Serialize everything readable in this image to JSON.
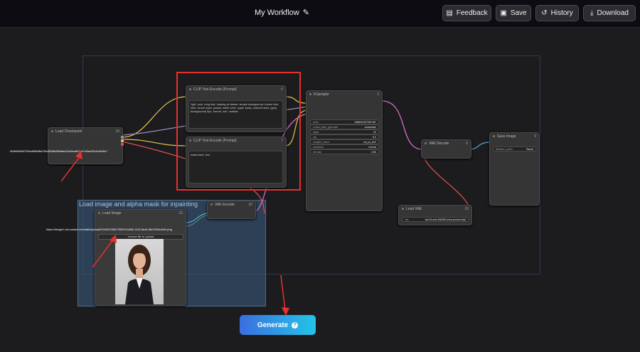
{
  "header": {
    "title": "My Workflow",
    "buttons": {
      "feedback": "Feedback",
      "save": "Save",
      "history": "History",
      "download": "Download"
    }
  },
  "nodes": {
    "load_checkpoint": {
      "title": "Load Checkpoint",
      "id": "29",
      "value": "0b5b0689470f4cd08b56a7f0c0558b2f8b8ed22a3ea5b7ae7d3ac02b2e4fd5c7"
    },
    "clip_pos": {
      "title": "CLIP Text Encode (Prompt)",
      "id": "6",
      "text": "1girl, solo, long hair, looking at viewer, simple background, brown hair, shirt, brown eyes, jacket, white shirt, upper body, collared shirt, (grey background) lips, formal, suit, realistic"
    },
    "clip_neg": {
      "title": "CLIP Text Encode (Prompt)",
      "id": "7",
      "text": "watermark, text"
    },
    "ksampler": {
      "title": "KSampler",
      "id": "3",
      "widgets": [
        {
          "label": "seed",
          "value": "1088411927287187"
        },
        {
          "label": "control_after_generate",
          "value": "randomize"
        },
        {
          "label": "steps",
          "value": "20"
        },
        {
          "label": "cfg",
          "value": "8.0"
        },
        {
          "label": "sampler_name",
          "value": "uni_pc_bh2"
        },
        {
          "label": "scheduler",
          "value": "normal"
        },
        {
          "label": "denoise",
          "value": "0.80"
        }
      ]
    },
    "vae_decode": {
      "title": "VAE Decode",
      "id": "8"
    },
    "save_image": {
      "title": "Save Image",
      "id": "9",
      "prefix_label": "filename_prefix",
      "prefix_value": "Result"
    },
    "load_vae": {
      "title": "Load VAE",
      "id": "33",
      "label": "vae",
      "value": "sdxl-ft-mse-840000-ema-pruned.ckpt"
    },
    "vae_encode": {
      "title": "VAE Encode",
      "id": "30"
    },
    "load_image": {
      "title": "Load Image",
      "id": "20",
      "url": "https://image1.cdn.seaart.me/static/upload/20240223/82750915-b852-412f-8ec6-f8e1920ec6d2.png",
      "upload": "choose file to upload"
    }
  },
  "group": {
    "title": "Load image and alpha mask for inpainting"
  },
  "generate": {
    "label": "Generate",
    "help": "?"
  },
  "colors": {
    "accent_red": "#e53030",
    "generate_from": "#3a6fe0",
    "generate_to": "#23c4e8"
  }
}
